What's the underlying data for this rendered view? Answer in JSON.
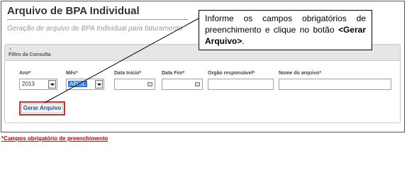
{
  "page": {
    "title": "Arquivo de BPA Individual",
    "subtitle": "Geração de arquivo de BPA Individual para faturamento"
  },
  "panel": {
    "chevron": "›",
    "title": "Filtro da Consulta"
  },
  "required_mark": "*",
  "fields": {
    "ano": {
      "label": "Ano",
      "value": "2013"
    },
    "mes": {
      "label": "Mês",
      "value": "ABRIL"
    },
    "data_inicio": {
      "label": "Data Início",
      "value": ""
    },
    "data_fim": {
      "label": "Data Fim",
      "value": ""
    },
    "orgao": {
      "label": "Orgão responsável",
      "value": ""
    },
    "nome_arquivo": {
      "label": "Nome do arquivo",
      "value": ""
    }
  },
  "button": {
    "label": "Gerar Arquivo"
  },
  "callout": {
    "text_before": "Informe os campos obrigatórios de preenchimento e clique no botão ",
    "button_ref": "<Gerar Arquivo>",
    "text_after": "."
  },
  "footnote": {
    "mark": "*",
    "text": "Campos obrigatório de preenchimento"
  },
  "colors": {
    "accent_red": "#c0392b",
    "link_blue": "#1f4fa0",
    "selected_highlight": "#3875d7"
  }
}
